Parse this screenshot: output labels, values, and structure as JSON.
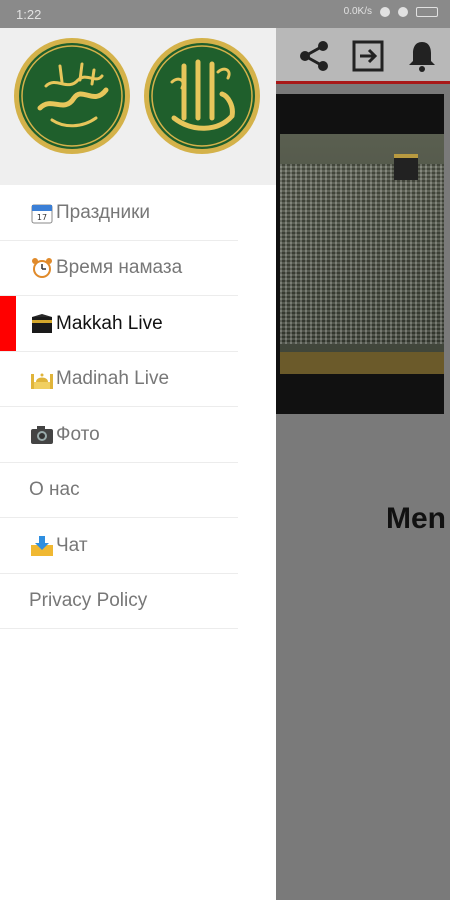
{
  "status_bar": {
    "time": "1:22",
    "speed": "0.0K/s"
  },
  "toolbar": {
    "icons": [
      "share-icon",
      "exit-icon",
      "bell-icon"
    ]
  },
  "background": {
    "menu_text": "Men"
  },
  "drawer": {
    "items": [
      {
        "label": "Праздники",
        "icon": "calendar-icon",
        "active": false
      },
      {
        "label": "Время намаза",
        "icon": "alarm-clock-icon",
        "active": false
      },
      {
        "label": "Makkah Live",
        "icon": "kaaba-icon",
        "active": true
      },
      {
        "label": "Madinah Live",
        "icon": "mosque-icon",
        "active": false
      },
      {
        "label": "Фото",
        "icon": "camera-icon",
        "active": false
      },
      {
        "label": "О нас",
        "icon": "",
        "active": false
      },
      {
        "label": "Чат",
        "icon": "inbox-download-icon",
        "active": false
      },
      {
        "label": "Privacy Policy",
        "icon": "",
        "active": false
      }
    ]
  },
  "colors": {
    "accent": "#ff0000",
    "toolbar_underline": "#a81818",
    "medallion_green": "#1f5f2c",
    "gold": "#d4b24a"
  }
}
